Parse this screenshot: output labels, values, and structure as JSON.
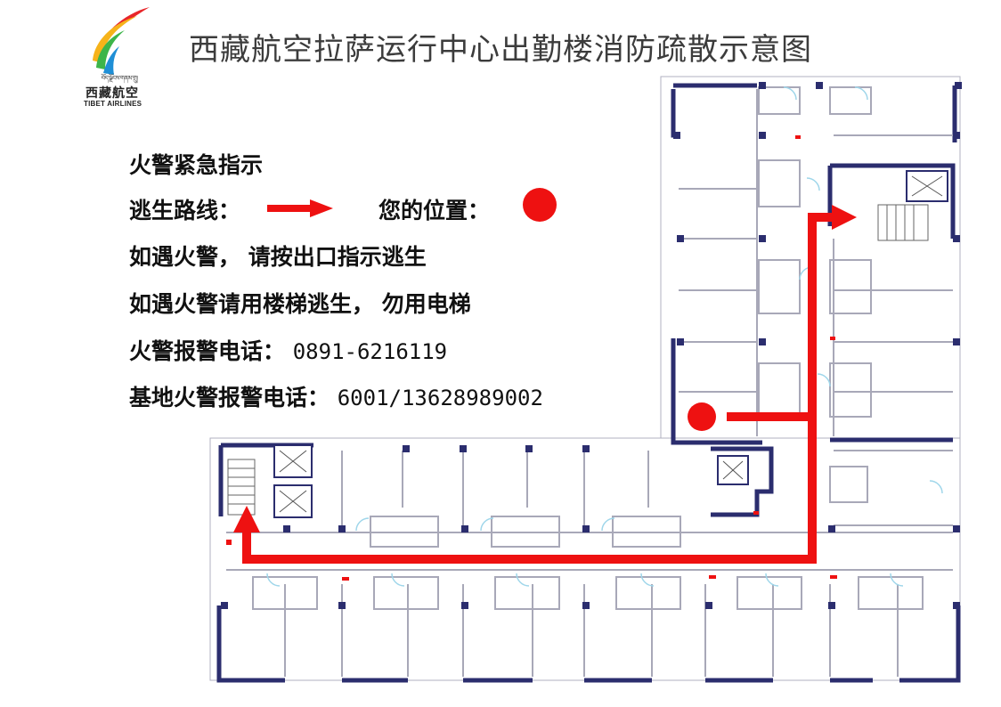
{
  "logo": {
    "script_text": "བོད་ལྗོངས་གནམ་གྲུ།",
    "chinese_name": "西藏航空",
    "english_name": "TIBET AIRLINES",
    "colors": [
      "#e8262a",
      "#f6b31a",
      "#3db54a",
      "#1f8fd6"
    ]
  },
  "title": "西藏航空拉萨运行中心出勤楼消防疏散示意图",
  "instructions": {
    "heading": "火警紧急指示",
    "route_label": "逃生路线：",
    "position_label": "您的位置：",
    "line_exit": "如遇火警， 请按出口指示逃生",
    "line_stairs": "如遇火警请用楼梯逃生， 勿用电梯",
    "fire_phone_label": "火警报警电话：",
    "fire_phone_number": "0891-6216119",
    "base_phone_label": "基地火警报警电话：",
    "base_phone_number": "6001/13628989002"
  },
  "colors": {
    "route": "#ee1111",
    "wall": "#2b2d6e",
    "partition": "#a8a8b8",
    "door": "#9fd6ea",
    "title": "#3c3c3c"
  },
  "map": {
    "route_color": "red",
    "marker_color": "red"
  }
}
